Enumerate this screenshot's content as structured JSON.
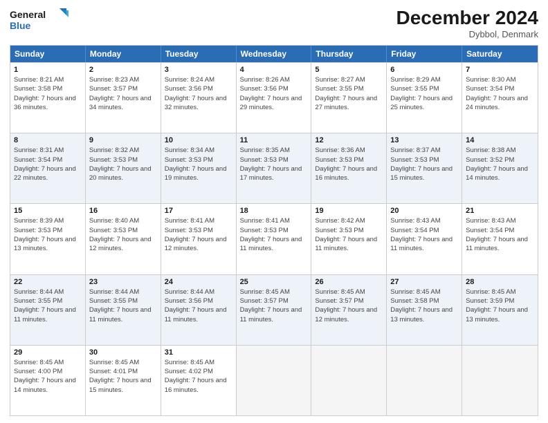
{
  "logo": {
    "line1": "General",
    "line2": "Blue"
  },
  "title": "December 2024",
  "subtitle": "Dybbol, Denmark",
  "headers": [
    "Sunday",
    "Monday",
    "Tuesday",
    "Wednesday",
    "Thursday",
    "Friday",
    "Saturday"
  ],
  "weeks": [
    [
      {
        "day": "1",
        "rise": "Sunrise: 8:21 AM",
        "set": "Sunset: 3:58 PM",
        "daylight": "Daylight: 7 hours and 36 minutes."
      },
      {
        "day": "2",
        "rise": "Sunrise: 8:23 AM",
        "set": "Sunset: 3:57 PM",
        "daylight": "Daylight: 7 hours and 34 minutes."
      },
      {
        "day": "3",
        "rise": "Sunrise: 8:24 AM",
        "set": "Sunset: 3:56 PM",
        "daylight": "Daylight: 7 hours and 32 minutes."
      },
      {
        "day": "4",
        "rise": "Sunrise: 8:26 AM",
        "set": "Sunset: 3:56 PM",
        "daylight": "Daylight: 7 hours and 29 minutes."
      },
      {
        "day": "5",
        "rise": "Sunrise: 8:27 AM",
        "set": "Sunset: 3:55 PM",
        "daylight": "Daylight: 7 hours and 27 minutes."
      },
      {
        "day": "6",
        "rise": "Sunrise: 8:29 AM",
        "set": "Sunset: 3:55 PM",
        "daylight": "Daylight: 7 hours and 25 minutes."
      },
      {
        "day": "7",
        "rise": "Sunrise: 8:30 AM",
        "set": "Sunset: 3:54 PM",
        "daylight": "Daylight: 7 hours and 24 minutes."
      }
    ],
    [
      {
        "day": "8",
        "rise": "Sunrise: 8:31 AM",
        "set": "Sunset: 3:54 PM",
        "daylight": "Daylight: 7 hours and 22 minutes."
      },
      {
        "day": "9",
        "rise": "Sunrise: 8:32 AM",
        "set": "Sunset: 3:53 PM",
        "daylight": "Daylight: 7 hours and 20 minutes."
      },
      {
        "day": "10",
        "rise": "Sunrise: 8:34 AM",
        "set": "Sunset: 3:53 PM",
        "daylight": "Daylight: 7 hours and 19 minutes."
      },
      {
        "day": "11",
        "rise": "Sunrise: 8:35 AM",
        "set": "Sunset: 3:53 PM",
        "daylight": "Daylight: 7 hours and 17 minutes."
      },
      {
        "day": "12",
        "rise": "Sunrise: 8:36 AM",
        "set": "Sunset: 3:53 PM",
        "daylight": "Daylight: 7 hours and 16 minutes."
      },
      {
        "day": "13",
        "rise": "Sunrise: 8:37 AM",
        "set": "Sunset: 3:53 PM",
        "daylight": "Daylight: 7 hours and 15 minutes."
      },
      {
        "day": "14",
        "rise": "Sunrise: 8:38 AM",
        "set": "Sunset: 3:52 PM",
        "daylight": "Daylight: 7 hours and 14 minutes."
      }
    ],
    [
      {
        "day": "15",
        "rise": "Sunrise: 8:39 AM",
        "set": "Sunset: 3:53 PM",
        "daylight": "Daylight: 7 hours and 13 minutes."
      },
      {
        "day": "16",
        "rise": "Sunrise: 8:40 AM",
        "set": "Sunset: 3:53 PM",
        "daylight": "Daylight: 7 hours and 12 minutes."
      },
      {
        "day": "17",
        "rise": "Sunrise: 8:41 AM",
        "set": "Sunset: 3:53 PM",
        "daylight": "Daylight: 7 hours and 12 minutes."
      },
      {
        "day": "18",
        "rise": "Sunrise: 8:41 AM",
        "set": "Sunset: 3:53 PM",
        "daylight": "Daylight: 7 hours and 11 minutes."
      },
      {
        "day": "19",
        "rise": "Sunrise: 8:42 AM",
        "set": "Sunset: 3:53 PM",
        "daylight": "Daylight: 7 hours and 11 minutes."
      },
      {
        "day": "20",
        "rise": "Sunrise: 8:43 AM",
        "set": "Sunset: 3:54 PM",
        "daylight": "Daylight: 7 hours and 11 minutes."
      },
      {
        "day": "21",
        "rise": "Sunrise: 8:43 AM",
        "set": "Sunset: 3:54 PM",
        "daylight": "Daylight: 7 hours and 11 minutes."
      }
    ],
    [
      {
        "day": "22",
        "rise": "Sunrise: 8:44 AM",
        "set": "Sunset: 3:55 PM",
        "daylight": "Daylight: 7 hours and 11 minutes."
      },
      {
        "day": "23",
        "rise": "Sunrise: 8:44 AM",
        "set": "Sunset: 3:55 PM",
        "daylight": "Daylight: 7 hours and 11 minutes."
      },
      {
        "day": "24",
        "rise": "Sunrise: 8:44 AM",
        "set": "Sunset: 3:56 PM",
        "daylight": "Daylight: 7 hours and 11 minutes."
      },
      {
        "day": "25",
        "rise": "Sunrise: 8:45 AM",
        "set": "Sunset: 3:57 PM",
        "daylight": "Daylight: 7 hours and 11 minutes."
      },
      {
        "day": "26",
        "rise": "Sunrise: 8:45 AM",
        "set": "Sunset: 3:57 PM",
        "daylight": "Daylight: 7 hours and 12 minutes."
      },
      {
        "day": "27",
        "rise": "Sunrise: 8:45 AM",
        "set": "Sunset: 3:58 PM",
        "daylight": "Daylight: 7 hours and 13 minutes."
      },
      {
        "day": "28",
        "rise": "Sunrise: 8:45 AM",
        "set": "Sunset: 3:59 PM",
        "daylight": "Daylight: 7 hours and 13 minutes."
      }
    ],
    [
      {
        "day": "29",
        "rise": "Sunrise: 8:45 AM",
        "set": "Sunset: 4:00 PM",
        "daylight": "Daylight: 7 hours and 14 minutes."
      },
      {
        "day": "30",
        "rise": "Sunrise: 8:45 AM",
        "set": "Sunset: 4:01 PM",
        "daylight": "Daylight: 7 hours and 15 minutes."
      },
      {
        "day": "31",
        "rise": "Sunrise: 8:45 AM",
        "set": "Sunset: 4:02 PM",
        "daylight": "Daylight: 7 hours and 16 minutes."
      },
      null,
      null,
      null,
      null
    ]
  ]
}
